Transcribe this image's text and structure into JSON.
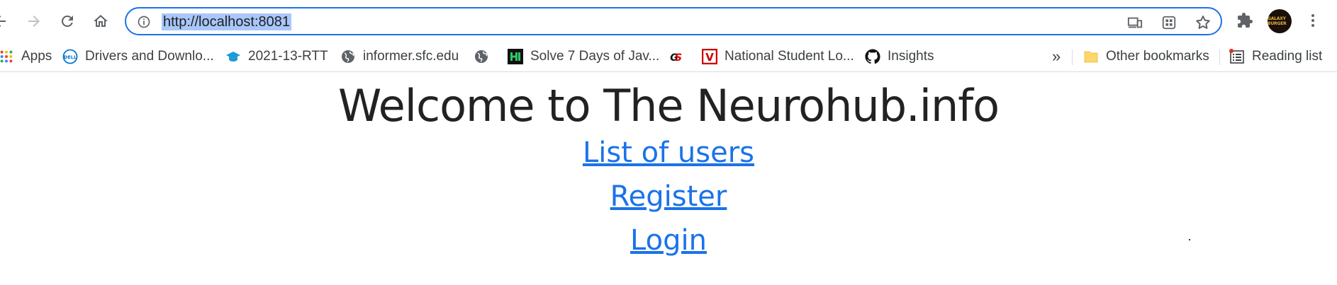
{
  "browser": {
    "url": "http://localhost:8081",
    "avatar_text": "GALAXY BURGER"
  },
  "bookmarks": [
    {
      "label": "Apps",
      "icon": "apps-grid-icon"
    },
    {
      "label": "Drivers and Downlo...",
      "icon": "dell-icon"
    },
    {
      "label": "2021-13-RTT",
      "icon": "graduation-cap-icon"
    },
    {
      "label": "informer.sfc.edu",
      "icon": "globe-icon"
    },
    {
      "label": "",
      "icon": "globe-icon"
    },
    {
      "label": "Solve 7 Days of Jav...",
      "icon": "hackerrank-icon"
    },
    {
      "label": "",
      "icon": "gs-icon",
      "glyph": "GS"
    },
    {
      "label": "National Student Lo...",
      "icon": "v-logo-icon",
      "glyph": "V"
    },
    {
      "label": "Insights",
      "icon": "github-icon"
    }
  ],
  "bookmarks_overflow": "»",
  "other_bookmarks": "Other bookmarks",
  "reading_list": "Reading list",
  "page": {
    "heading": "Welcome to The Neurohub.info",
    "links": [
      "List of users",
      "Register",
      "Login"
    ]
  }
}
